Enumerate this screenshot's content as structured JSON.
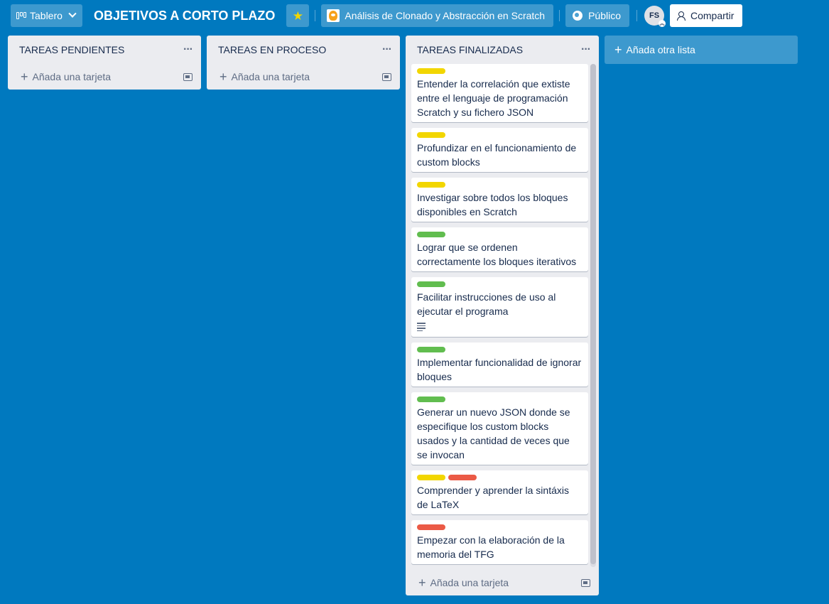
{
  "header": {
    "board_switch_label": "Tablero",
    "board_title": "OBJETIVOS A CORTO PLAZO",
    "team_label": "Análisis de Clonado y Abstracción en Scratch",
    "visibility_label": "Público",
    "avatar_initials": "FS",
    "share_label": "Compartir"
  },
  "colors": {
    "background": "#0079bf",
    "label_yellow": "#f2d600",
    "label_green": "#61bd4f",
    "label_red": "#eb5a46"
  },
  "lists": [
    {
      "title": "TAREAS PENDIENTES",
      "add_card_label": "Añada una tarjeta",
      "cards": []
    },
    {
      "title": "TAREAS EN PROCESO",
      "add_card_label": "Añada una tarjeta",
      "cards": []
    },
    {
      "title": "TAREAS FINALIZADAS",
      "add_card_label": "Añada una tarjeta",
      "cards": [
        {
          "labels": [
            "yellow"
          ],
          "text": "Entender la correlación que extiste entre el lenguaje de programación Scratch y su fichero JSON"
        },
        {
          "labels": [
            "yellow"
          ],
          "text": "Profundizar en el funcionamiento de custom blocks"
        },
        {
          "labels": [
            "yellow"
          ],
          "text": "Investigar sobre todos los bloques disponibles en Scratch"
        },
        {
          "labels": [
            "green"
          ],
          "text": "Lograr que se ordenen correctamente los bloques iterativos"
        },
        {
          "labels": [
            "green"
          ],
          "text": "Facilitar instrucciones de uso al ejecutar el programa",
          "has_description": true
        },
        {
          "labels": [
            "green"
          ],
          "text": "Implementar funcionalidad de ignorar bloques"
        },
        {
          "labels": [
            "green"
          ],
          "text": "Generar un nuevo JSON donde se especifique los custom blocks usados y la cantidad de veces que se invocan"
        },
        {
          "labels": [
            "yellow",
            "red"
          ],
          "text": "Comprender y aprender la sintáxis de LaTeX"
        },
        {
          "labels": [
            "red"
          ],
          "text": "Empezar con la elaboración de la memoria del TFG"
        }
      ]
    }
  ],
  "add_list_label": "Añada otra lista"
}
